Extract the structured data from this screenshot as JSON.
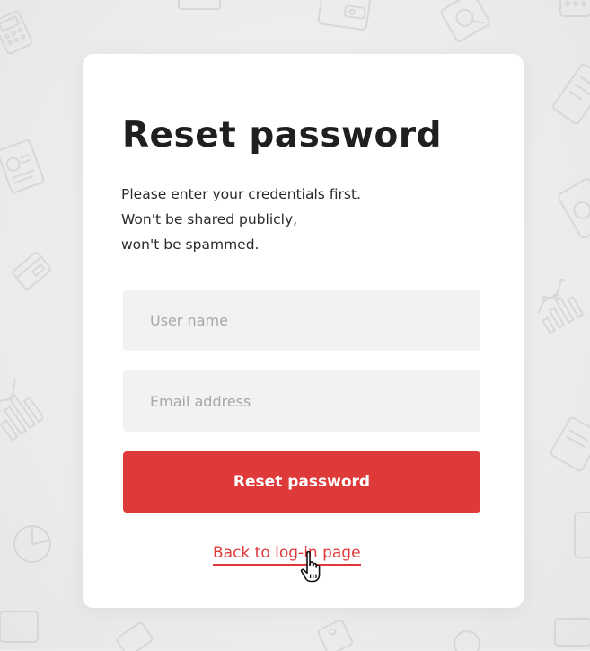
{
  "page": {
    "background_color": "#ececec",
    "card_color": "#ffffff",
    "accent_color": "#df3a3a"
  },
  "form": {
    "title": "Reset password",
    "description": [
      "Please enter your credentials first.",
      "Won't be shared publicly,",
      "won't be spammed."
    ],
    "username": {
      "placeholder": "User name",
      "value": ""
    },
    "email": {
      "placeholder": "Email address",
      "value": ""
    },
    "submit_label": "Reset password",
    "back_link_label": "Back to log-in page"
  },
  "cursor": {
    "type": "hand-pointer-icon"
  },
  "background_icons": [
    "calculator-icon",
    "wallet-icon",
    "card-icon",
    "magnifier-chart-icon",
    "clipboard-chart-icon",
    "bar-chart-icon",
    "pie-chart-icon",
    "document-icon",
    "coin-icon",
    "line-chart-icon"
  ]
}
